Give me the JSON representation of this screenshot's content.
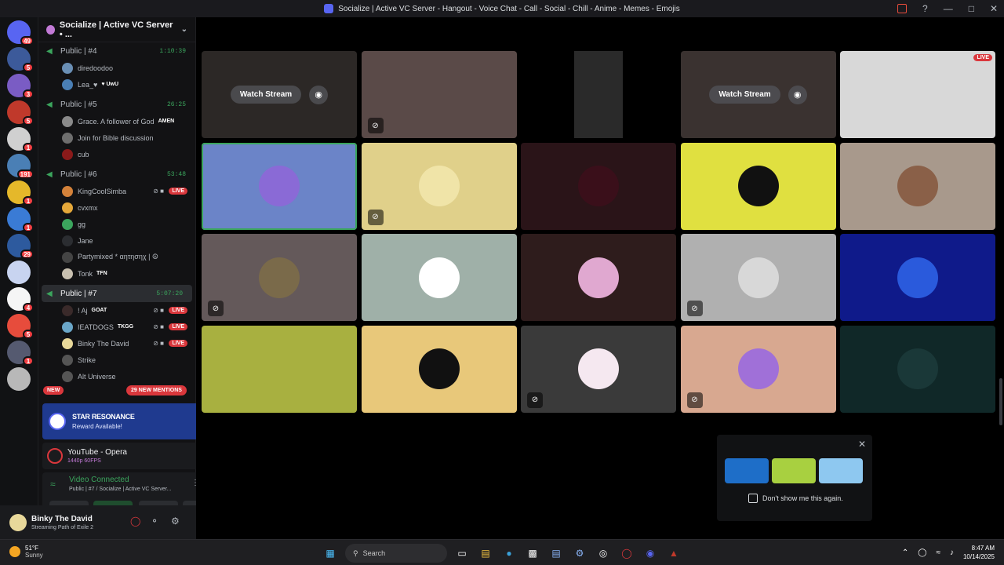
{
  "window": {
    "title": "Socialize | Active VC Server - Hangout - Voice Chat - Call - Social - Chill - Anime - Memes - Emojis"
  },
  "guilds": [
    {
      "color": "#5865f2",
      "badge": "49"
    },
    {
      "color": "#3c5a9a",
      "badge": "5"
    },
    {
      "color": "#7a5cc4",
      "badge": "3"
    },
    {
      "color": "#c0392b",
      "badge": "5"
    },
    {
      "color": "#d0d0d0",
      "badge": "1"
    },
    {
      "color": "#4a7fb5",
      "badge": "191"
    },
    {
      "color": "#e5b82a",
      "badge": "1"
    },
    {
      "color": "#3a7bd5",
      "badge": "1"
    },
    {
      "color": "#2d5a9e",
      "badge": "29"
    },
    {
      "color": "#c8d4f0",
      "badge": ""
    },
    {
      "color": "#f5f5f5",
      "badge": "4"
    },
    {
      "color": "#e74c3c",
      "badge": "5"
    },
    {
      "color": "#555a70",
      "badge": "1"
    },
    {
      "color": "#b8b8b8",
      "badge": ""
    }
  ],
  "sidebar": {
    "server_name": "Socialize | Active VC Server • ...",
    "new_label": "NEW",
    "mentions": "29 NEW MENTIONS",
    "channels": [
      {
        "name": "Public | #4",
        "timer": "1:10:39",
        "members": [
          {
            "name": "diredoodoo",
            "color": "#6a8fb5"
          },
          {
            "name": "Lea_♥",
            "tag": "♥ UwU",
            "color": "#4a7fb5"
          }
        ]
      },
      {
        "name": "Public | #5",
        "timer": "26:25",
        "members": [
          {
            "name": "Grace. A follower of God",
            "tag": "AMEN",
            "color": "#8a8a8a"
          },
          {
            "name": "Join for Bible discussion",
            "color": "#6e6e6e"
          },
          {
            "name": "cub",
            "color": "#8b1a1a"
          }
        ]
      },
      {
        "name": "Public | #6",
        "timer": "53:48",
        "members": [
          {
            "name": "KingCoolSimba",
            "live": "LIVE",
            "color": "#d4823a"
          },
          {
            "name": "cvxmx",
            "color": "#e5a83a"
          },
          {
            "name": "gg",
            "color": "#3ba55d"
          },
          {
            "name": "Jane",
            "color": "#2b2d31"
          },
          {
            "name": "Partymixed * αητησηχ | ☮",
            "color": "#444"
          },
          {
            "name": "Tonk",
            "tag": "TFN",
            "color": "#c8c0b0"
          }
        ]
      },
      {
        "name": "Public | #7",
        "timer": "5:07:20",
        "active": true,
        "members": [
          {
            "name": "! Aj",
            "tag": "GOAT",
            "live": "LIVE",
            "color": "#3a2a2a"
          },
          {
            "name": "IEATDOGS",
            "tag": "TKGG",
            "live": "LIVE",
            "color": "#6aa6c8"
          },
          {
            "name": "Binky The David",
            "live": "LIVE",
            "color": "#e8d89a"
          },
          {
            "name": "Strike",
            "color": "#555"
          },
          {
            "name": "Alt Universe",
            "color": "#555"
          }
        ]
      }
    ]
  },
  "promo": {
    "title": "STAR RESONANCE",
    "subtitle": "Reward Available!"
  },
  "activity": {
    "title": "YouTube - Opera",
    "subtitle": "1440p 60FPS"
  },
  "voice_panel": {
    "status": "Video Connected",
    "channel": "Public | #7 / Socialize | Active VC Server..."
  },
  "user": {
    "name": "Binky The David",
    "status": "Streaming Path of Exile 2"
  },
  "stage": {
    "watch_stream_label": "Watch Stream",
    "live_label": "LIVE",
    "tiles": [
      {
        "kind": "stream",
        "bg": "#2c2826",
        "watch": true
      },
      {
        "kind": "stream",
        "bg": "#5a4a48",
        "muted": true
      },
      {
        "kind": "phone",
        "bg": "#000000"
      },
      {
        "kind": "stream",
        "bg": "#3a3230",
        "watch": true
      },
      {
        "kind": "stream",
        "bg": "#d8d8d8",
        "live": true
      },
      {
        "kind": "user",
        "bg": "#6b84c8",
        "av": "#8a6ad6",
        "selected": true
      },
      {
        "kind": "user",
        "bg": "#e0d08a",
        "av": "#f0e4a8",
        "muted": true
      },
      {
        "kind": "user",
        "bg": "#2a1418",
        "av": "#3a0f1a"
      },
      {
        "kind": "user",
        "bg": "#e0e040",
        "av": "#111111"
      },
      {
        "kind": "user",
        "bg": "#a8998c",
        "av": "#8a6048"
      },
      {
        "kind": "user",
        "bg": "#64595a",
        "av": "#7a6a4a",
        "muted": true
      },
      {
        "kind": "user",
        "bg": "#9fb0a8",
        "av": "#ffffff"
      },
      {
        "kind": "user",
        "bg": "#2e1c1c",
        "av": "#e0a8d0"
      },
      {
        "kind": "user",
        "bg": "#b0b0b0",
        "av": "#d8d8d8",
        "muted": true
      },
      {
        "kind": "user",
        "bg": "#0f1a8a",
        "av": "#2a5adc"
      },
      {
        "kind": "user",
        "bg": "#a8b040",
        "av": "#a8b040"
      },
      {
        "kind": "user",
        "bg": "#e8c87a",
        "av": "#111111"
      },
      {
        "kind": "user",
        "bg": "#3a3a3a",
        "av": "#f5e8f0",
        "muted": true
      },
      {
        "kind": "user",
        "bg": "#d8a890",
        "av": "#a070d8",
        "deaf": true
      },
      {
        "kind": "user",
        "bg": "#102828",
        "av": "#1a3838"
      }
    ]
  },
  "popup": {
    "checkbox_label": "Don't show me this again.",
    "games": [
      "#1e6ec8",
      "#a8d040",
      "#8ec8f0"
    ]
  },
  "taskbar": {
    "temp": "51°F",
    "weather": "Sunny",
    "search": "Search",
    "time": "8:47 AM",
    "date": "10/14/2025"
  },
  "colors": {
    "accent": "#5865f2",
    "green": "#3ba55d",
    "red": "#da373c"
  }
}
